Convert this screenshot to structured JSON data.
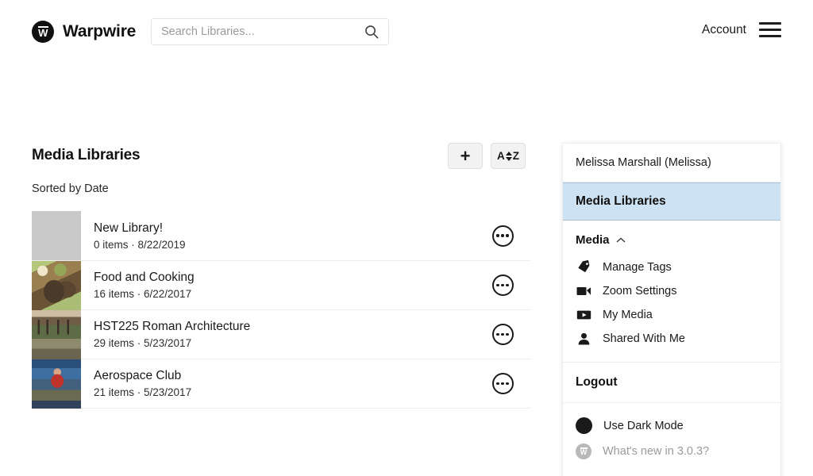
{
  "header": {
    "brand_name": "Warpwire",
    "logo_letter": "W",
    "search": {
      "placeholder": "Search Libraries...",
      "value": "",
      "icon": "search-icon"
    },
    "account_label": "Account",
    "menu_icon": "hamburger-menu-icon"
  },
  "main": {
    "page_title": "Media Libraries",
    "sorted_by": "Sorted by Date",
    "add_button": {
      "label": "+",
      "icon": "plus-icon"
    },
    "sort_button": {
      "label": "AZ",
      "icon": "sort-alpha-icon"
    },
    "row_action_icon": "more-options-icon",
    "libraries": [
      {
        "name": "New Library!",
        "meta": "0 items · 8/22/2019",
        "items": "0 items",
        "date": "8/22/2019",
        "thumb_kind": "placeholder-empty"
      },
      {
        "name": "Food and Cooking",
        "meta": "16 items · 6/22/2017",
        "items": "16 items",
        "date": "6/22/2017",
        "thumb_kind": "photo-vegetables"
      },
      {
        "name": "HST225 Roman Architecture",
        "meta": "29 items · 5/23/2017",
        "items": "29 items",
        "date": "5/23/2017",
        "thumb_kind": "photo-roman-courtyard"
      },
      {
        "name": "Aerospace Club",
        "meta": "21 items · 5/23/2017",
        "items": "21 items",
        "date": "5/23/2017",
        "thumb_kind": "photo-astronaut"
      }
    ]
  },
  "side_panel": {
    "user": "Melissa Marshall (Melissa)",
    "active_item": "Media Libraries",
    "media_section": {
      "label": "Media",
      "chevron": "chevron-up-icon",
      "items": [
        {
          "label": "Manage Tags",
          "icon": "tag-icon"
        },
        {
          "label": "Zoom Settings",
          "icon": "video-camera-icon"
        },
        {
          "label": "My Media",
          "icon": "play-rectangle-icon"
        },
        {
          "label": "Shared With Me",
          "icon": "person-icon"
        }
      ]
    },
    "logout": "Logout",
    "footer": [
      {
        "label": "Use Dark Mode",
        "icon": "dark-mode-circle-icon"
      },
      {
        "label": "What's new in 3.0.3?",
        "icon": "warpwire-gray-icon"
      }
    ]
  },
  "colors": {
    "active_bg": "#cde2f2",
    "active_border": "#a8c3d6",
    "accent_dark": "#1a1a1a",
    "muted_text": "#9b9b9b"
  }
}
